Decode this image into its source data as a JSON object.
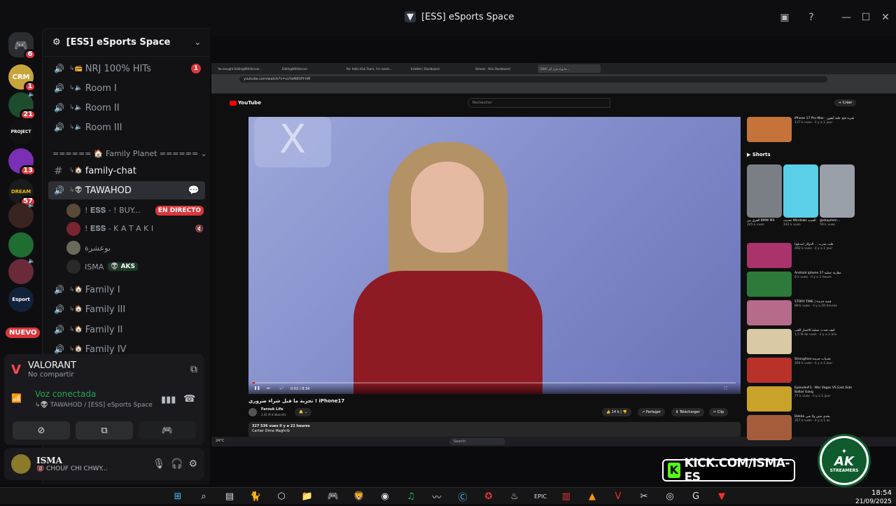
{
  "window": {
    "title": "[ESS] eSports Space"
  },
  "rail": {
    "servers": [
      {
        "label": "",
        "badge": "6",
        "color": "#5865f2"
      },
      {
        "label": "CRM",
        "badge": "1",
        "color": "#c9a43a"
      },
      {
        "label": "",
        "badge": "21",
        "color": "#1d4d2c"
      },
      {
        "label": "PROJECT",
        "badge": "",
        "color": "#111"
      },
      {
        "label": "",
        "badge": "13",
        "color": "#7a2fb5"
      },
      {
        "label": "DREAM",
        "badge": "57",
        "color": "#1b1b1b"
      },
      {
        "label": "",
        "badge": "",
        "color": "#3a2420"
      },
      {
        "label": "",
        "badge": "",
        "color": "#1f6e31"
      },
      {
        "label": "",
        "badge": "",
        "color": "#6a2a3a"
      },
      {
        "label": "Esport",
        "badge": "",
        "color": "#12223a"
      }
    ],
    "new_label": "NUEVO"
  },
  "server": {
    "name": "[ESS] eSports Space"
  },
  "channels": {
    "top": [
      {
        "name": "NRJ 100% HITs",
        "mention": "1"
      },
      {
        "name": "Room I"
      },
      {
        "name": "Room II"
      },
      {
        "name": "Room III"
      }
    ],
    "category": "====== 🏠 Family Planet ======",
    "text_channel": "family-chat",
    "active_voice": "TAWAHOD",
    "voice_users": [
      {
        "name": "! 𝐄𝐒𝐒 - ! BUY...",
        "live": "EN DIRECTO"
      },
      {
        "name": "! 𝐄𝐒𝐒 - K A T A K I",
        "live": ""
      },
      {
        "name": "بوعشرة",
        "live": ""
      },
      {
        "name": "ISMA",
        "tag": "AKS",
        "live": ""
      }
    ],
    "bottom": [
      {
        "name": "Family I"
      },
      {
        "name": "Family III"
      },
      {
        "name": "Family II"
      },
      {
        "name": "Family IV"
      }
    ]
  },
  "activity": {
    "game": "VALORANT",
    "status": "No compartir"
  },
  "voice": {
    "status": "Voz conectada",
    "location": "TAWAHOD / [ESS] eSports Space"
  },
  "user": {
    "name": "ISMA",
    "status": "CHOUF CHI CHWY..."
  },
  "stream": {
    "tabs": [
      "You bought EditingWithServer...",
      "EditingWithServer",
      "Re: Hello Kick Team, I'm reachi...",
      "KickBot | Dashboard",
      "Stream - Kick Dashboard",
      "(184) ما وراء قرار آبل..."
    ],
    "url": "youtube.com/watch?v=csYwNKVH-hM",
    "yt_logo": "YouTube",
    "search_placeholder": "Rechercher",
    "create_label": "+ Créer",
    "video_time": "0:02 / 8:34",
    "video_title": "تجربة ما قبل شراء ضروري ! iPhone17",
    "channel_name": "Farouk Life",
    "subscribers": "2,01 M d'abonnés",
    "likes": "14 k",
    "share_label": "Partager",
    "download_label": "Télécharger",
    "clip_label": "Clip",
    "views": "327 536 vues  Il y a 22 heures",
    "desc_line": "Cartier Dima Maghrib",
    "shorts_label": "Shorts",
    "recommended": [
      {
        "title": "iPhone 17 Pro Max - تجربة فتح علبة آيفون",
        "meta": "137 k vues · il y a 1 jour",
        "color": "#c6733a"
      },
      {
        "title": "قلب مدرب ... الدولار (مدبلج)",
        "meta": "492 k vues · il y a 1 jour",
        "color": "#a9336a"
      },
      {
        "title": "Android iphone 17 مقارنة عملية",
        "meta": "6 k vues · il y a 1 heure",
        "color": "#2d7a3a"
      },
      {
        "title": "STORY TIME | قصة جديدة",
        "meta": "89 k vues · il y a 20 heures",
        "color": "#b76b8a"
      },
      {
        "title": "كيف تحدث عملية الاختيار للعب",
        "meta": "1,5 M de vues · il y a 2 ans",
        "color": "#d9c9a4"
      },
      {
        "title": "Stronghive تحديات جديدة",
        "meta": "264 k vues · il y a 1 jour",
        "color": "#b8322a"
      },
      {
        "title": "Episode#3 : War Vegas VS East Side Ballas Gang",
        "meta": "77 k vues · il y a 1 jour",
        "color": "#c9a22a"
      },
      {
        "title": "Dekka يحدي منين ولا شي",
        "meta": "357 k vues · il y a 1 an",
        "color": "#a55c3a"
      }
    ],
    "shorts": [
      {
        "caption": "الفرق بين BMW M3",
        "meta": "245 k vues",
        "color": "#7a7f86"
      },
      {
        "caption": "تحديث Windows الجديد",
        "meta": "142 k vues",
        "color": "#5ad0e8"
      },
      {
        "caption": "@skaymen...",
        "meta": "59 k vues",
        "color": "#9aa0a8"
      }
    ],
    "taskbar_search": "Search",
    "weather": "24°C"
  },
  "overlay": {
    "kick_text": "KICK.COM/ISMA-ES",
    "ak_text": "AK",
    "ak_sub": "STREAMERS"
  },
  "taskbar": {
    "time": "18:54",
    "date": "21/09/2025"
  }
}
